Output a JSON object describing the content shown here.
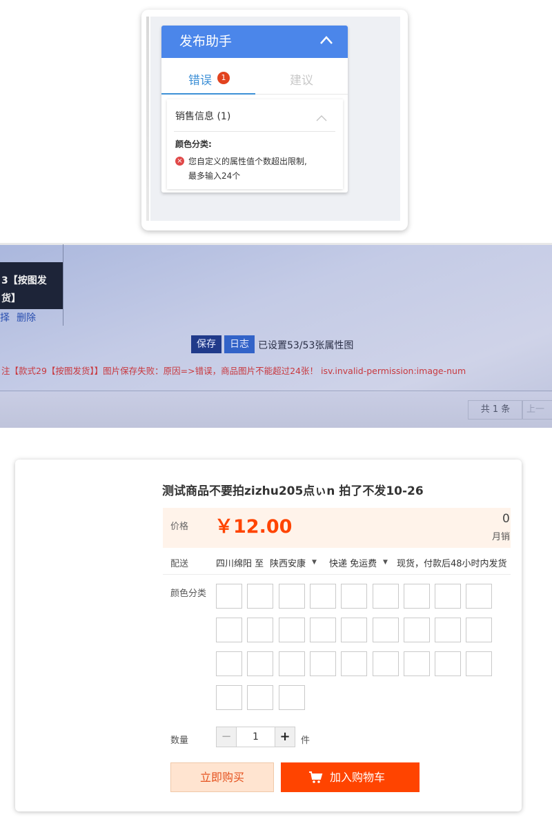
{
  "assistant": {
    "title": "发布助手",
    "tabs": {
      "error_label": "错误",
      "error_count": "1",
      "suggest_label": "建议"
    },
    "section_title": "销售信息 (1)",
    "field_label": "颜色分类:",
    "error_line1": "您自定义的属性值个数超出限制,",
    "error_line2": "最多输入24个",
    "colors": {
      "header": "#4b86ea",
      "tab_active": "#3c8fd6",
      "badge": "#e2431f"
    }
  },
  "admin": {
    "sku_line1": "3【按图发",
    "sku_line2": "货】",
    "select_link": "择",
    "delete_link": "删除",
    "save_button": "保存",
    "log_button": "日志",
    "image_status": "已设置53/53张属性图",
    "error_message": "注【款式29【按图发货】】图片保存失败：原因=>错误，商品图片不能超过24张！ isv.invalid-permission:image-num",
    "pagination_total": "共 1 条",
    "pagination_prev": "上一"
  },
  "product": {
    "title": "测试商品不要拍zizhu205点ぃn 拍了不发10-26",
    "price_label": "价格",
    "price": "￥12.00",
    "monthly_sales_count": "0",
    "monthly_sales_label": "月销",
    "shipping": {
      "label": "配送",
      "from": "四川绵阳 至",
      "to": "陕西安康",
      "method": "快递 免运费",
      "note": "现货，付款后48小时内发货"
    },
    "color_label": "颜色分类",
    "color_swatch_count": 30,
    "quantity_label": "数量",
    "quantity_value": "1",
    "quantity_unit": "件",
    "minus_symbol": "−",
    "plus_symbol": "+",
    "buy_now": "立即购买",
    "add_to_cart": "加入购物车",
    "colors": {
      "accent": "#ff4400",
      "price_bg": "#fff3ea",
      "buy_now_bg": "#ffe4d0"
    }
  }
}
